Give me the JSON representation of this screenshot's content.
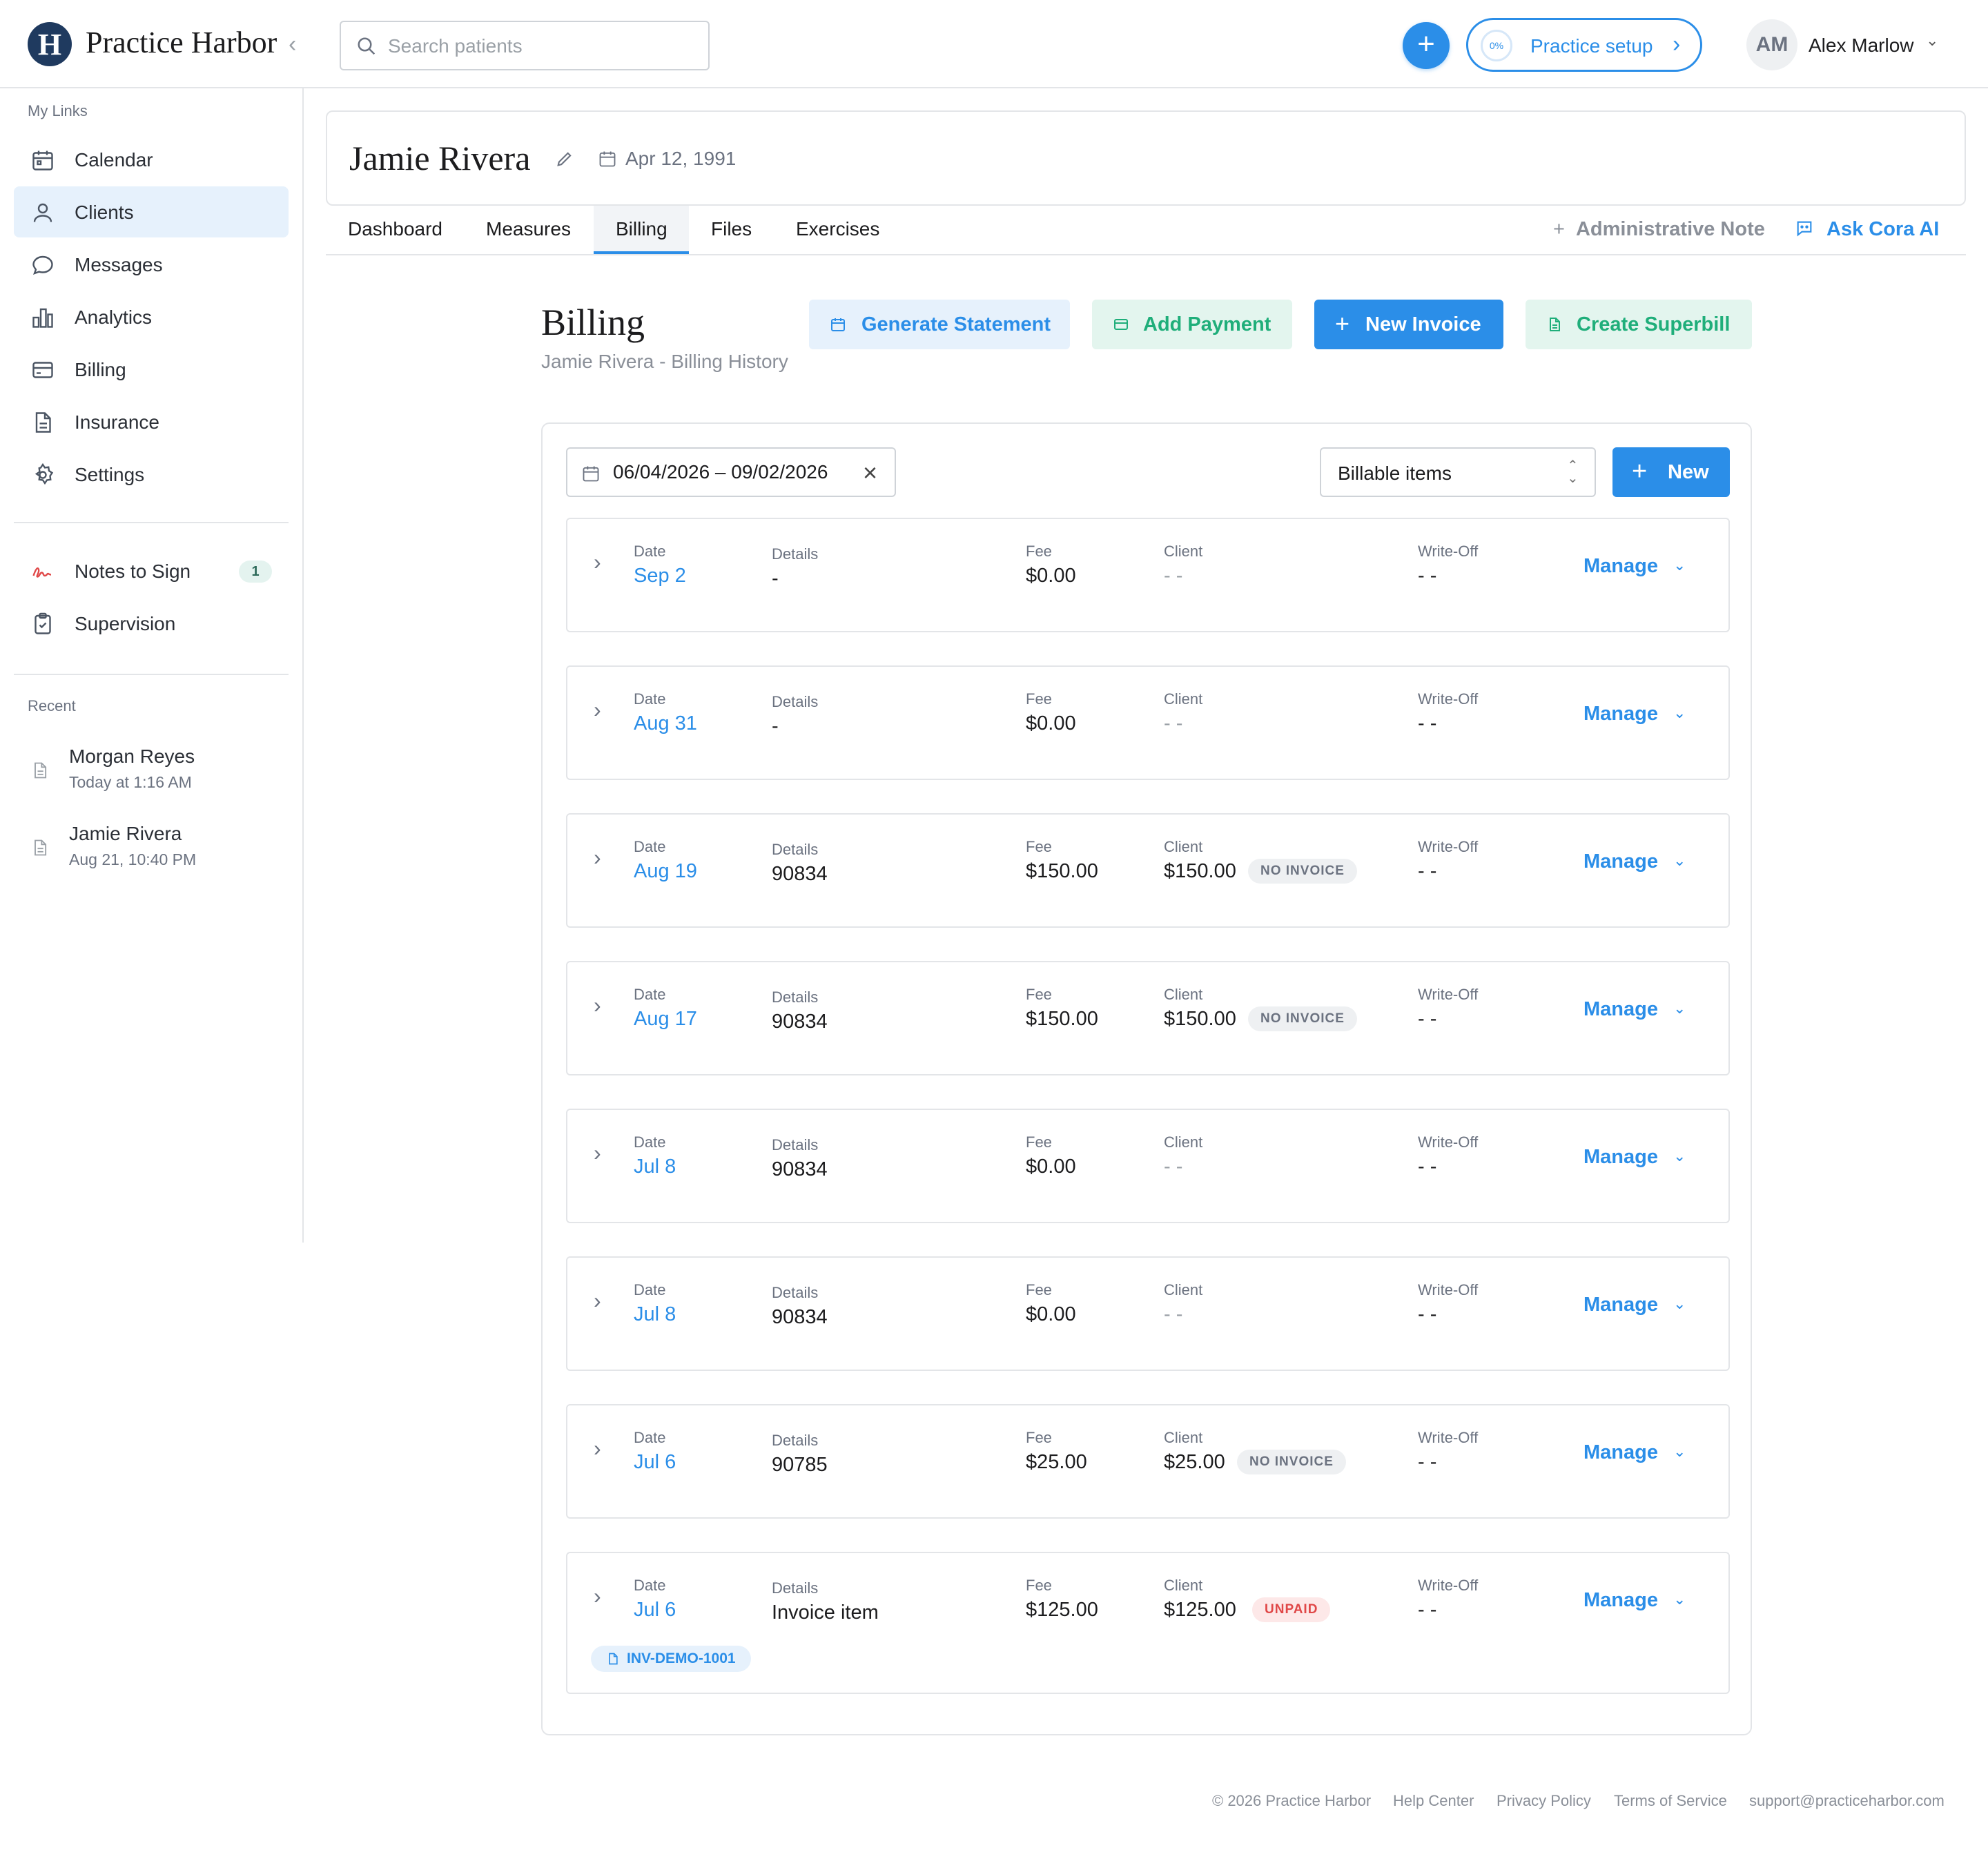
{
  "app": {
    "brand": "Practice Harbor",
    "logo_letter": "H"
  },
  "header": {
    "search_placeholder": "Search patients",
    "setup": {
      "progress": "0%",
      "label": "Practice setup"
    },
    "user": {
      "initials": "AM",
      "name": "Alex Marlow"
    }
  },
  "sidebar": {
    "my_links_label": "My Links",
    "items": [
      {
        "label": "Calendar",
        "icon": "calendar-icon"
      },
      {
        "label": "Clients",
        "icon": "user-icon",
        "active": true
      },
      {
        "label": "Messages",
        "icon": "chat-icon"
      },
      {
        "label": "Analytics",
        "icon": "bar-chart-icon"
      },
      {
        "label": "Billing",
        "icon": "credit-card-icon"
      },
      {
        "label": "Insurance",
        "icon": "document-icon"
      },
      {
        "label": "Settings",
        "icon": "gear-icon"
      }
    ],
    "secondary": [
      {
        "label": "Notes to Sign",
        "icon": "signature-icon",
        "badge": "1"
      },
      {
        "label": "Supervision",
        "icon": "clipboard-check-icon"
      }
    ],
    "recent_label": "Recent",
    "recent": [
      {
        "name": "Morgan Reyes",
        "time": "Today at 1:16 AM"
      },
      {
        "name": "Jamie Rivera",
        "time": "Aug 21, 10:40 PM"
      }
    ]
  },
  "patient": {
    "name": "Jamie Rivera",
    "dob": "Apr 12, 1991"
  },
  "tabs": [
    "Dashboard",
    "Measures",
    "Billing",
    "Files",
    "Exercises"
  ],
  "tab_actions": {
    "admin_note": "Administrative Note",
    "ask_ai": "Ask Cora AI"
  },
  "billing": {
    "title": "Billing",
    "subtitle": "Jamie Rivera - Billing History",
    "actions": {
      "generate_statement": "Generate Statement",
      "add_payment": "Add Payment",
      "new_invoice": "New Invoice",
      "create_superbill": "Create Superbill"
    },
    "filters": {
      "date_range": "06/04/2026 – 09/02/2026",
      "type": "Billable items",
      "new_label": "New"
    },
    "columns": {
      "date": "Date",
      "details": "Details",
      "fee": "Fee",
      "client": "Client",
      "writeoff": "Write-Off"
    },
    "manage_label": "Manage",
    "rows": [
      {
        "date": "Sep 2",
        "details": "-",
        "fee": "$0.00",
        "client": "- -",
        "status": "",
        "writeoff": "- -"
      },
      {
        "date": "Aug 31",
        "details": "-",
        "fee": "$0.00",
        "client": "- -",
        "status": "",
        "writeoff": "- -"
      },
      {
        "date": "Aug 19",
        "details": "90834",
        "fee": "$150.00",
        "client": "$150.00",
        "status": "NO INVOICE",
        "writeoff": "- -"
      },
      {
        "date": "Aug 17",
        "details": "90834",
        "fee": "$150.00",
        "client": "$150.00",
        "status": "NO INVOICE",
        "writeoff": "- -"
      },
      {
        "date": "Jul 8",
        "details": "90834",
        "fee": "$0.00",
        "client": "- -",
        "status": "",
        "writeoff": "- -"
      },
      {
        "date": "Jul 8",
        "details": "90834",
        "fee": "$0.00",
        "client": "- -",
        "status": "",
        "writeoff": "- -"
      },
      {
        "date": "Jul 6",
        "details": "90785",
        "fee": "$25.00",
        "client": "$25.00",
        "status": "NO INVOICE",
        "writeoff": "- -"
      },
      {
        "date": "Jul 6",
        "details": "Invoice item",
        "fee": "$125.00",
        "client": "$125.00",
        "status": "UNPAID",
        "writeoff": "- -",
        "invoice": "INV-DEMO-1001"
      }
    ]
  },
  "footer": {
    "copyright": "© 2026 Practice Harbor",
    "links": [
      "Help Center",
      "Privacy Policy",
      "Terms of Service"
    ],
    "email": "support@practiceharbor.com"
  },
  "colors": {
    "accent": "#2b8ee8",
    "green": "#1fae7a",
    "danger": "#e04848"
  }
}
